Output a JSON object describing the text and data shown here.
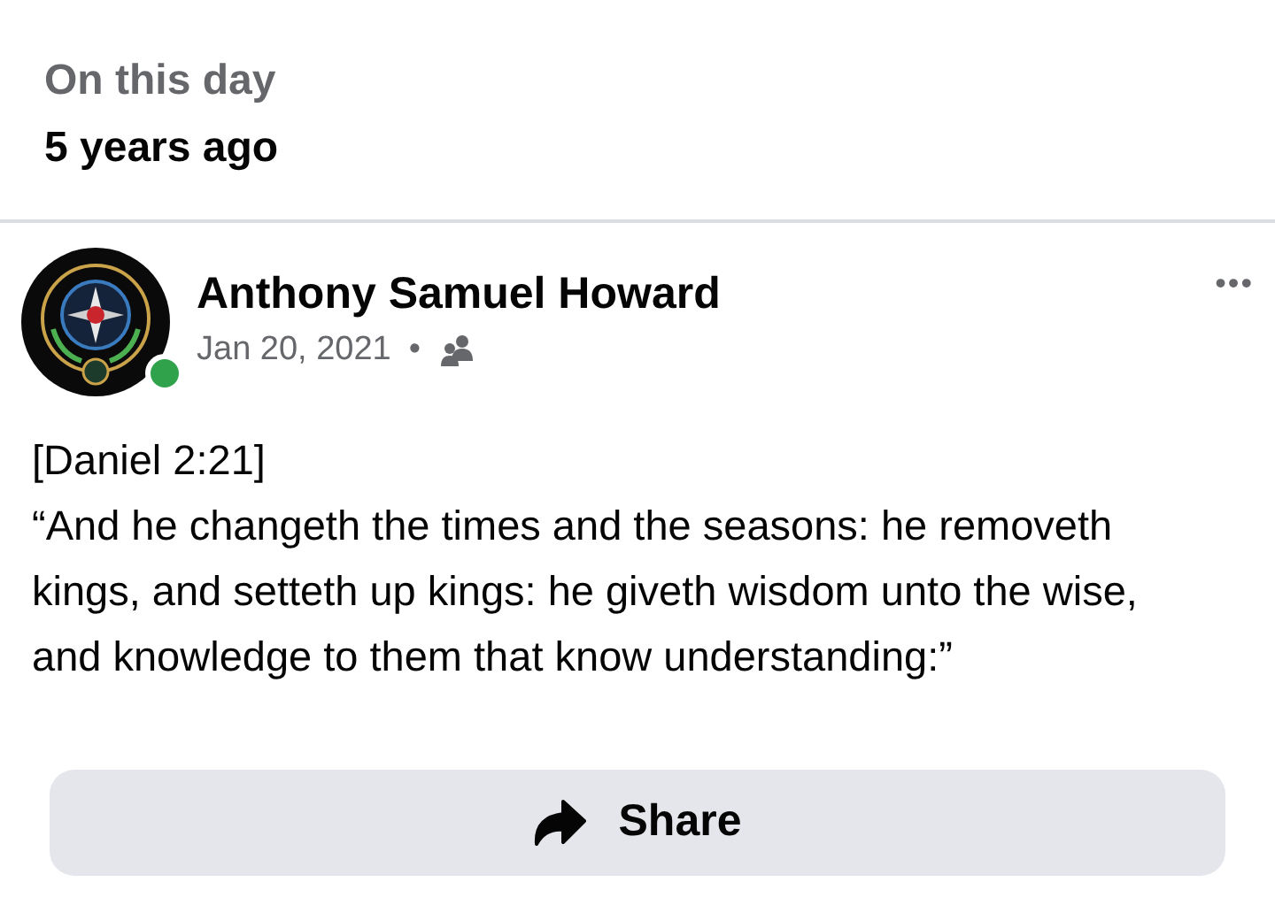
{
  "memory": {
    "title": "On this day",
    "subtitle": "5 years ago"
  },
  "post": {
    "author": "Anthony Samuel Howard",
    "online": true,
    "date": "Jan 20, 2021",
    "separator": "•",
    "menu": "•••",
    "reference": "[Daniel 2:21]",
    "text": "“And he changeth the times and the seasons: he removeth kings, and setteth up kings: he giveth wisdom unto the wise, and knowledge to them that know understanding:”"
  },
  "share_button": {
    "label": "Share"
  }
}
